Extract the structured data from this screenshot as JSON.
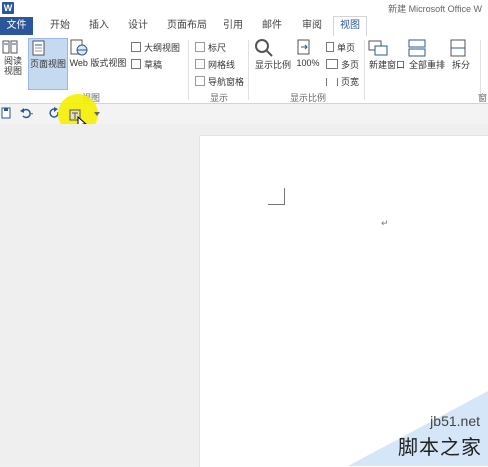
{
  "app": {
    "logo": "W",
    "title": "新建 Microsoft Office W"
  },
  "tabs": [
    {
      "label": "文件"
    },
    {
      "label": "开始"
    },
    {
      "label": "插入"
    },
    {
      "label": "设计"
    },
    {
      "label": "页面布局"
    },
    {
      "label": "引用"
    },
    {
      "label": "邮件"
    },
    {
      "label": "审阅"
    },
    {
      "label": "视图"
    }
  ],
  "ribbon": {
    "views_group": {
      "label": "视图",
      "read_mode": "阅读\n视图",
      "print_layout": "页面视图",
      "web_layout": "Web 版式视图",
      "outline": "大纲视图",
      "draft": "草稿"
    },
    "show_group": {
      "label": "显示",
      "ruler": "标尺",
      "gridlines": "网格线",
      "nav_pane": "导航窗格"
    },
    "zoom_group": {
      "label": "显示比例",
      "zoom": "显示比例",
      "hundred": "100%",
      "one_page": "单页",
      "multi_page": "多页",
      "page_width": "页宽"
    },
    "window_group": {
      "label": "窗口",
      "new_window": "新建窗口",
      "arrange_all": "全部重排",
      "split": "拆分"
    }
  },
  "watermark": {
    "site": "jb51.net",
    "name": "脚本之家"
  },
  "colors": {
    "accent": "#2b579a",
    "highlight": "#f4f000"
  }
}
